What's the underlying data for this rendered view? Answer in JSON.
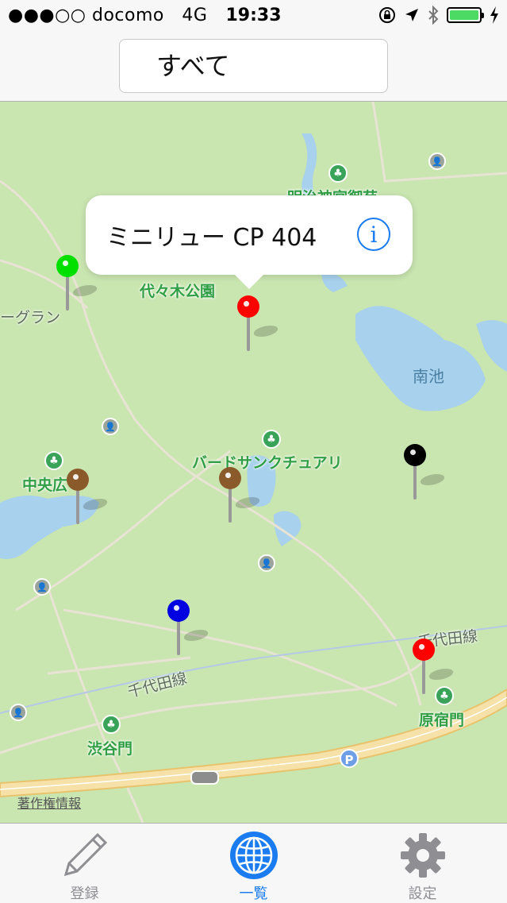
{
  "status_bar": {
    "carrier": "●●●○○ docomo",
    "network": "4G",
    "time": "19:33"
  },
  "nav": {
    "segment_label": "すべて"
  },
  "map": {
    "callout": {
      "title": "ミニリュー  CP 404",
      "info_icon": "info-icon"
    },
    "labels": {
      "park_top": "明治神宮御苑",
      "yoyogi_park": "代々木公園",
      "left_edge": "ーグラン",
      "pond_south": "南池",
      "bird_sanctuary": "バードサンクチュアリ",
      "central_plaza": "中央広",
      "chiyoda_line_left": "千代田線",
      "chiyoda_line_right": "千代田線",
      "harajuku_gate": "原宿門",
      "shibuya_gate": "渋谷門"
    },
    "pins": [
      {
        "color": "#00e000"
      },
      {
        "color": "#ff0000"
      },
      {
        "color": "#8b5a2b"
      },
      {
        "color": "#8b5a2b"
      },
      {
        "color": "#000000"
      },
      {
        "color": "#0000e0"
      },
      {
        "color": "#ff0000"
      }
    ],
    "parking_label": "P",
    "copyright": "著作権情報"
  },
  "tab_bar": {
    "tabs": [
      {
        "label": "登録",
        "icon": "pencil-icon",
        "active": false
      },
      {
        "label": "一覧",
        "icon": "globe-icon",
        "active": true
      },
      {
        "label": "設定",
        "icon": "gear-icon",
        "active": false
      }
    ]
  },
  "colors": {
    "accent": "#1a7cf0",
    "map_land": "#c9e5b0",
    "water": "#a7d1ec"
  }
}
